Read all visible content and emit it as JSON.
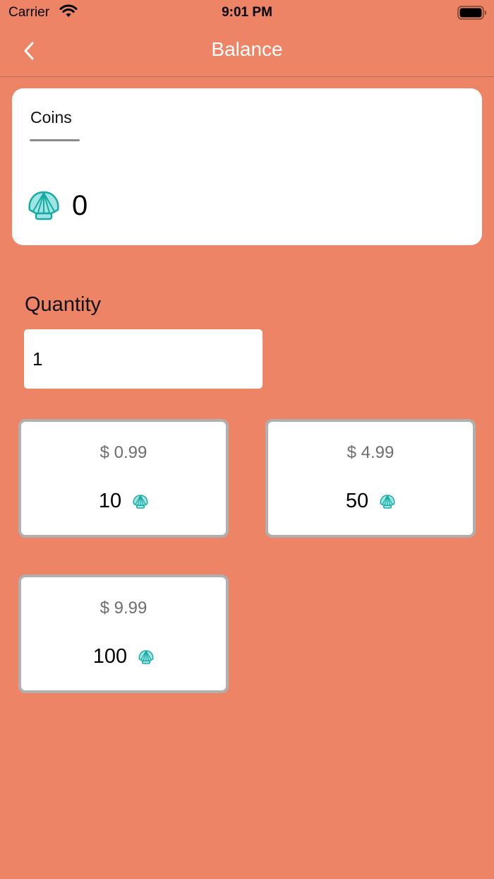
{
  "status_bar": {
    "carrier": "Carrier",
    "time": "9:01 PM"
  },
  "nav": {
    "title": "Balance",
    "back_icon": "chevron-left-icon"
  },
  "balance": {
    "tab_label": "Coins",
    "value": "0",
    "icon": "shell-icon",
    "icon_color": "#1BB5B0"
  },
  "quantity": {
    "label": "Quantity",
    "value": "1"
  },
  "packages": [
    {
      "price": "$ 0.99",
      "amount": "10"
    },
    {
      "price": "$ 4.99",
      "amount": "50"
    },
    {
      "price": "$ 9.99",
      "amount": "100"
    }
  ],
  "colors": {
    "background": "#EE8466",
    "card": "#FFFFFF",
    "tile_border": "#B0B0B0"
  }
}
